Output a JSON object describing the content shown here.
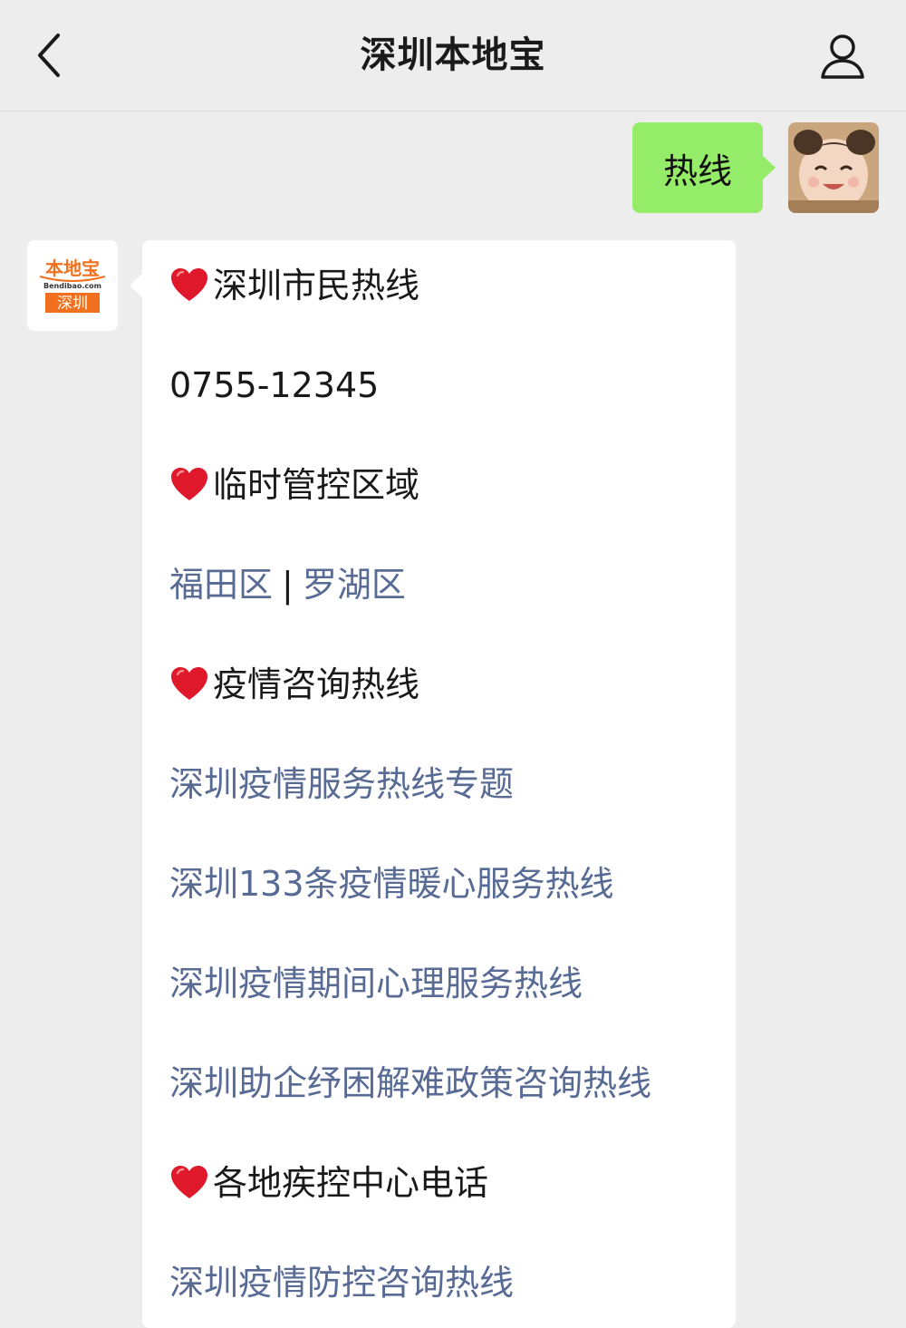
{
  "nav": {
    "title": "深圳本地宝"
  },
  "user_message": {
    "text": "热线"
  },
  "bot_avatar": {
    "brand": "本地宝",
    "domain": "Bendibao.com",
    "city": "深圳"
  },
  "bot_message": {
    "sections": [
      {
        "heading": "深圳市民热线",
        "lines": [
          "0755-12345"
        ]
      },
      {
        "heading": "临时管控区域",
        "links": [
          "福田区",
          "罗湖区"
        ],
        "separator": "|"
      },
      {
        "heading": "疫情咨询热线",
        "links": [
          "深圳疫情服务热线专题",
          "深圳133条疫情暖心服务热线",
          "深圳疫情期间心理服务热线",
          "深圳助企纾困解难政策咨询热线"
        ]
      },
      {
        "heading": "各地疾控中心电话",
        "links": [
          "深圳疫情防控咨询热线"
        ]
      }
    ]
  },
  "colors": {
    "background": "#ededed",
    "user_bubble": "#95ec69",
    "link": "#576b95",
    "heart": "#e0182b",
    "brand_orange": "#f2701d"
  },
  "icons": {
    "back": "chevron-left-icon",
    "profile": "person-icon",
    "heading_marker": "red-heart-icon"
  }
}
